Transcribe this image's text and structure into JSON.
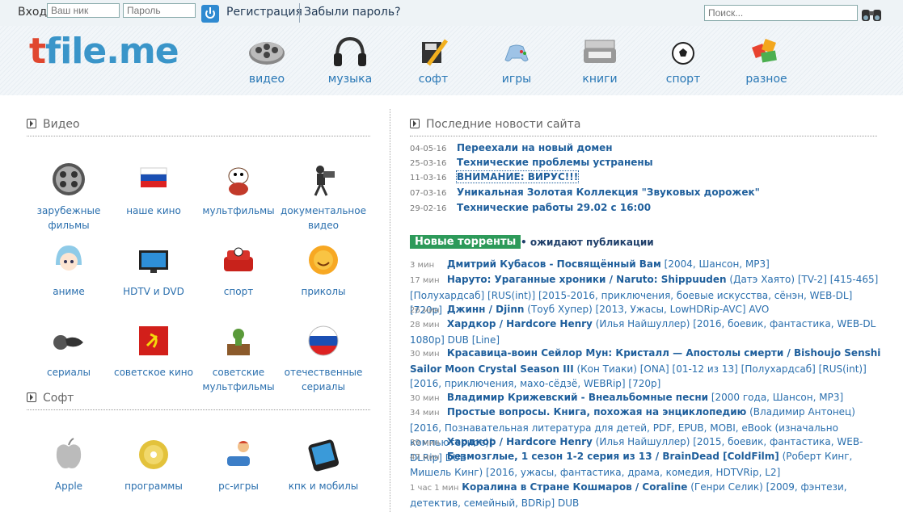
{
  "topbar": {
    "login_label": "Вход:",
    "nick_placeholder": "Ваш ник",
    "pass_placeholder": "Пароль",
    "register": "Регистрация",
    "forgot": "Забыли пароль?",
    "search_placeholder": "Поиск..."
  },
  "logo": {
    "t": "t",
    "rest": "file.me"
  },
  "categories": [
    {
      "label": "видео"
    },
    {
      "label": "музыка"
    },
    {
      "label": "софт"
    },
    {
      "label": "игры"
    },
    {
      "label": "книги"
    },
    {
      "label": "спорт"
    },
    {
      "label": "разное"
    }
  ],
  "video_section": {
    "title": "Видео",
    "tiles": [
      {
        "label": "зарубежные фильмы"
      },
      {
        "label": "наше кино"
      },
      {
        "label": "мультфильмы"
      },
      {
        "label": "документальное видео"
      },
      {
        "label": "аниме"
      },
      {
        "label": "HDTV и DVD"
      },
      {
        "label": "спорт"
      },
      {
        "label": "приколы"
      },
      {
        "label": "сериалы"
      },
      {
        "label": "советское кино"
      },
      {
        "label": "советские мультфильмы"
      },
      {
        "label": "отечественные сериалы"
      }
    ]
  },
  "soft_section": {
    "title": "Софт",
    "tiles": [
      {
        "label": "Apple"
      },
      {
        "label": "программы"
      },
      {
        "label": "pc-игры"
      },
      {
        "label": "кпк и мобилы"
      }
    ]
  },
  "news_section": {
    "title": "Последние новости сайта",
    "items": [
      {
        "date": "04-05-16",
        "text": "Переехали на новый домен"
      },
      {
        "date": "25-03-16",
        "text": "Технические проблемы устранены"
      },
      {
        "date": "11-03-16",
        "text": "ВНИМАНИЕ: ВИРУС!!!"
      },
      {
        "date": "07-03-16",
        "text": "Уникальная Золотая Коллекция \"Звуковых дорожек\""
      },
      {
        "date": "29-02-16",
        "text": "Технические работы 29.02 с 16:00"
      }
    ]
  },
  "torrents": {
    "badge": "Новые торренты",
    "await": "• ожидают публикации",
    "items": [
      {
        "time": "3 мин",
        "title": "Дмитрий Кубасов - Посвящённый Вам",
        "rest": " [2004, Шансон, MP3]"
      },
      {
        "time": "17 мин",
        "title": "Наруто: Ураганные хроники / Naruto: Shippuuden",
        "rest": " (Датэ Хаято) [TV-2] [415-465] [Полухардсаб] [RUS(int)] [2015-2016, приключения, боевые искусства, сёнэн, WEB-DL] [720p]"
      },
      {
        "time": "26 мин",
        "title": "Джинн / Djinn",
        "rest": " (Тоуб Хупер) [2013, Ужасы, LowHDRip-AVC] AVO"
      },
      {
        "time": "28 мин",
        "title": "Хардкор / Hardcore Henry",
        "rest": " (Илья Найшуллер) [2016, боевик, фантастика, WEB-DL 1080p] DUB [Line]"
      },
      {
        "time": "30 мин",
        "title": "Красавица-воин Сейлор Мун: Кристалл — Апостолы смерти / Bishoujo Senshi Sailor Moon Crystal Season III",
        "rest": " (Кон Тиаки) [ONA] [01-12 из 13] [Полухардсаб] [RUS(int)] [2016, приключения, махо-сёдзё, WEBRip] [720p]"
      },
      {
        "time": "30 мин",
        "title": "Владимир Крижевский - Внеальбомные песни",
        "rest": " [2000 года, Шансон, MP3]"
      },
      {
        "time": "34 мин",
        "title": "Простые вопросы. Книга, похожая на энциклопедию",
        "rest": " (Владимир Антонец) [2016, Познавательная литература для детей, PDF, EPUB, MOBI, eBook (изначально компьютерное)]"
      },
      {
        "time": "39 мин",
        "title": "Хардкор / Hardcore Henry",
        "rest": " (Илья Найшуллер) [2015, боевик, фантастика, WEB-DLRip] DUB"
      },
      {
        "time": "47 мин",
        "title": "Безмозглые, 1 сезон 1-2 серия из 13 / BrainDead [ColdFilm]",
        "rest": " (Роберт Кинг, Мишель Кинг) [2016, ужасы, фантастика, драма, комедия, HDTVRip, L2]"
      },
      {
        "time": "1 час 1 мин",
        "title": "Коралина в Стране Кошмаров / Coraline",
        "rest": " (Генри Селик) [2009, фэнтези, детектив, семейный, BDRip] DUB"
      }
    ]
  }
}
